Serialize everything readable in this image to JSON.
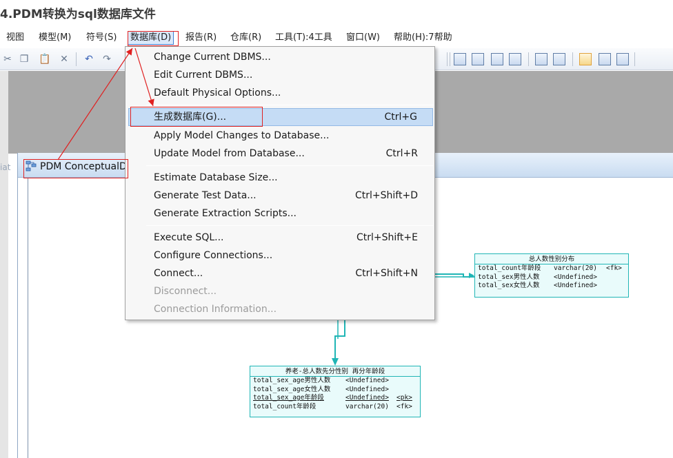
{
  "heading": "4.PDM转换为sql数据库文件",
  "menubar": {
    "items": [
      {
        "label": "视图"
      },
      {
        "label": "模型(M)"
      },
      {
        "label": "符号(S)"
      },
      {
        "label": "数据库(D)",
        "active": true
      },
      {
        "label": "报告(R)"
      },
      {
        "label": "仓库(R)"
      },
      {
        "label": "工具(T):4工具"
      },
      {
        "label": "窗口(W)"
      },
      {
        "label": "帮助(H):7帮助"
      }
    ]
  },
  "dropdown": {
    "groups": [
      [
        {
          "label": "Change Current DBMS...",
          "shortcut": ""
        },
        {
          "label": "Edit Current DBMS...",
          "shortcut": ""
        },
        {
          "label": "Default Physical Options...",
          "shortcut": ""
        }
      ],
      [
        {
          "label": "生成数据库(G)...",
          "shortcut": "Ctrl+G",
          "highlight": true
        },
        {
          "label": "Apply Model Changes to Database...",
          "shortcut": ""
        },
        {
          "label": "Update Model from Database...",
          "shortcut": "Ctrl+R"
        }
      ],
      [
        {
          "label": "Estimate Database Size...",
          "shortcut": ""
        },
        {
          "label": "Generate Test Data...",
          "shortcut": "Ctrl+Shift+D"
        },
        {
          "label": "Generate Extraction Scripts...",
          "shortcut": ""
        }
      ],
      [
        {
          "label": "Execute SQL...",
          "shortcut": "Ctrl+Shift+E"
        },
        {
          "label": "Configure Connections...",
          "shortcut": ""
        },
        {
          "label": "Connect...",
          "shortcut": "Ctrl+Shift+N"
        },
        {
          "label": "Disconnect...",
          "shortcut": "",
          "disabled": true
        },
        {
          "label": "Connection Information...",
          "shortcut": "",
          "disabled": true
        }
      ]
    ]
  },
  "document": {
    "title": "PDM ConceptualD",
    "left_fragment": "iat"
  },
  "entities": {
    "gender_distribution": {
      "title": "总人数性别分布",
      "rows": [
        {
          "name": "total_count年龄段",
          "type": "varchar(20)",
          "key": "<fk>"
        },
        {
          "name": "total_sex男性人数",
          "type": "<Undefined>",
          "key": ""
        },
        {
          "name": "total_sex女性人数",
          "type": "<Undefined>",
          "key": ""
        }
      ]
    },
    "pension_age": {
      "title": "养老-总人数先分性别 再分年龄段",
      "rows": [
        {
          "name": "total_sex_age男性人数",
          "type": "<Undefined>",
          "key": ""
        },
        {
          "name": "total_sex_age女性人数",
          "type": "<Undefined>",
          "key": ""
        },
        {
          "name": "total_sex_age年龄段",
          "type": "<Undefined>",
          "key": "<pk>",
          "underline": true
        },
        {
          "name": "total_count年龄段",
          "type": "varchar(20)",
          "key": "<fk>"
        }
      ]
    }
  },
  "colors": {
    "highlight_annotation": "#e02020",
    "entity_border": "#1fb5b5",
    "menu_highlight": "#c5dcf5"
  }
}
